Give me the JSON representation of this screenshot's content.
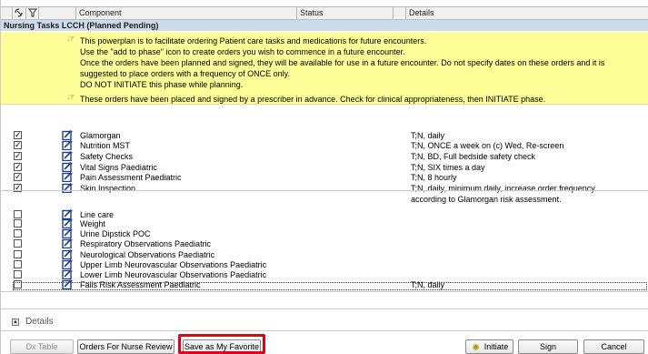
{
  "columns": {
    "component": "Component",
    "status": "Status",
    "details": "Details"
  },
  "phase_title": "Nursing Tasks LCCH (Planned Pending)",
  "note1": [
    "This powerplan is to facilitate ordering Patient care tasks and medications for future encounters.",
    "Use the \"add to phase\" icon to create orders you wish to commence in a future encounter.",
    "Once the orders have been planned and signed, they will be available for use in a future encounter. Do not specify dates on these orders and it is",
    "suggested to place orders with a frequency of ONCE only.",
    "DO NOT INITIATE this phase while planning."
  ],
  "note2": "These orders have been placed and signed by a prescriber in advance. Check for clinical appropriateness, then INITIATE phase.",
  "orders": [
    {
      "name": "Glamorgan",
      "checked": true,
      "details": "T;N, daily"
    },
    {
      "name": "Nutrition MST",
      "checked": true,
      "details": "T;N, ONCE a week on (c) Wed, Re-screen"
    },
    {
      "name": "Safety Checks",
      "checked": true,
      "details": "T;N, BD, Full bedside safety check"
    },
    {
      "name": "Vital Signs Paediatric",
      "checked": true,
      "details": "T;N, SIX times a day"
    },
    {
      "name": "Pain Assessment Paediatric",
      "checked": true,
      "details": "T;N, 8 hourly"
    },
    {
      "name": "Skin Inspection",
      "checked": true,
      "details": "T;N, daily, minimum daily, increase order frequency",
      "details2": "according to Glamorgan risk assessment."
    },
    {
      "name": "Line care",
      "checked": false,
      "details": ""
    },
    {
      "name": "Weight",
      "checked": false,
      "details": ""
    },
    {
      "name": "Urine Dipstick POC",
      "checked": false,
      "details": ""
    },
    {
      "name": "Respiratory Observations Paediatric",
      "checked": false,
      "details": ""
    },
    {
      "name": "Neurological Observations Paediatric",
      "checked": false,
      "details": ""
    },
    {
      "name": "Upper Limb Neurovascular Observations Paediatric",
      "checked": false,
      "details": ""
    },
    {
      "name": "Lower Limb Neurovascular Observations Paediatric",
      "checked": false,
      "details": ""
    },
    {
      "name": "Falls Risk Assessment Paediatric",
      "checked": false,
      "details": "T;N, daily"
    }
  ],
  "details_label": "Details",
  "buttons": {
    "dx_table": "Dx Table",
    "orders_for_nurse_review": "Orders For Nurse Review",
    "save_as_favorite": "Save as My Favorite",
    "initiate": "Initiate",
    "sign": "Sign",
    "cancel": "Cancel"
  },
  "colors": {
    "phase_header": "#ccdcec",
    "note_background": "#ffff99",
    "highlight": "#e3001b"
  }
}
